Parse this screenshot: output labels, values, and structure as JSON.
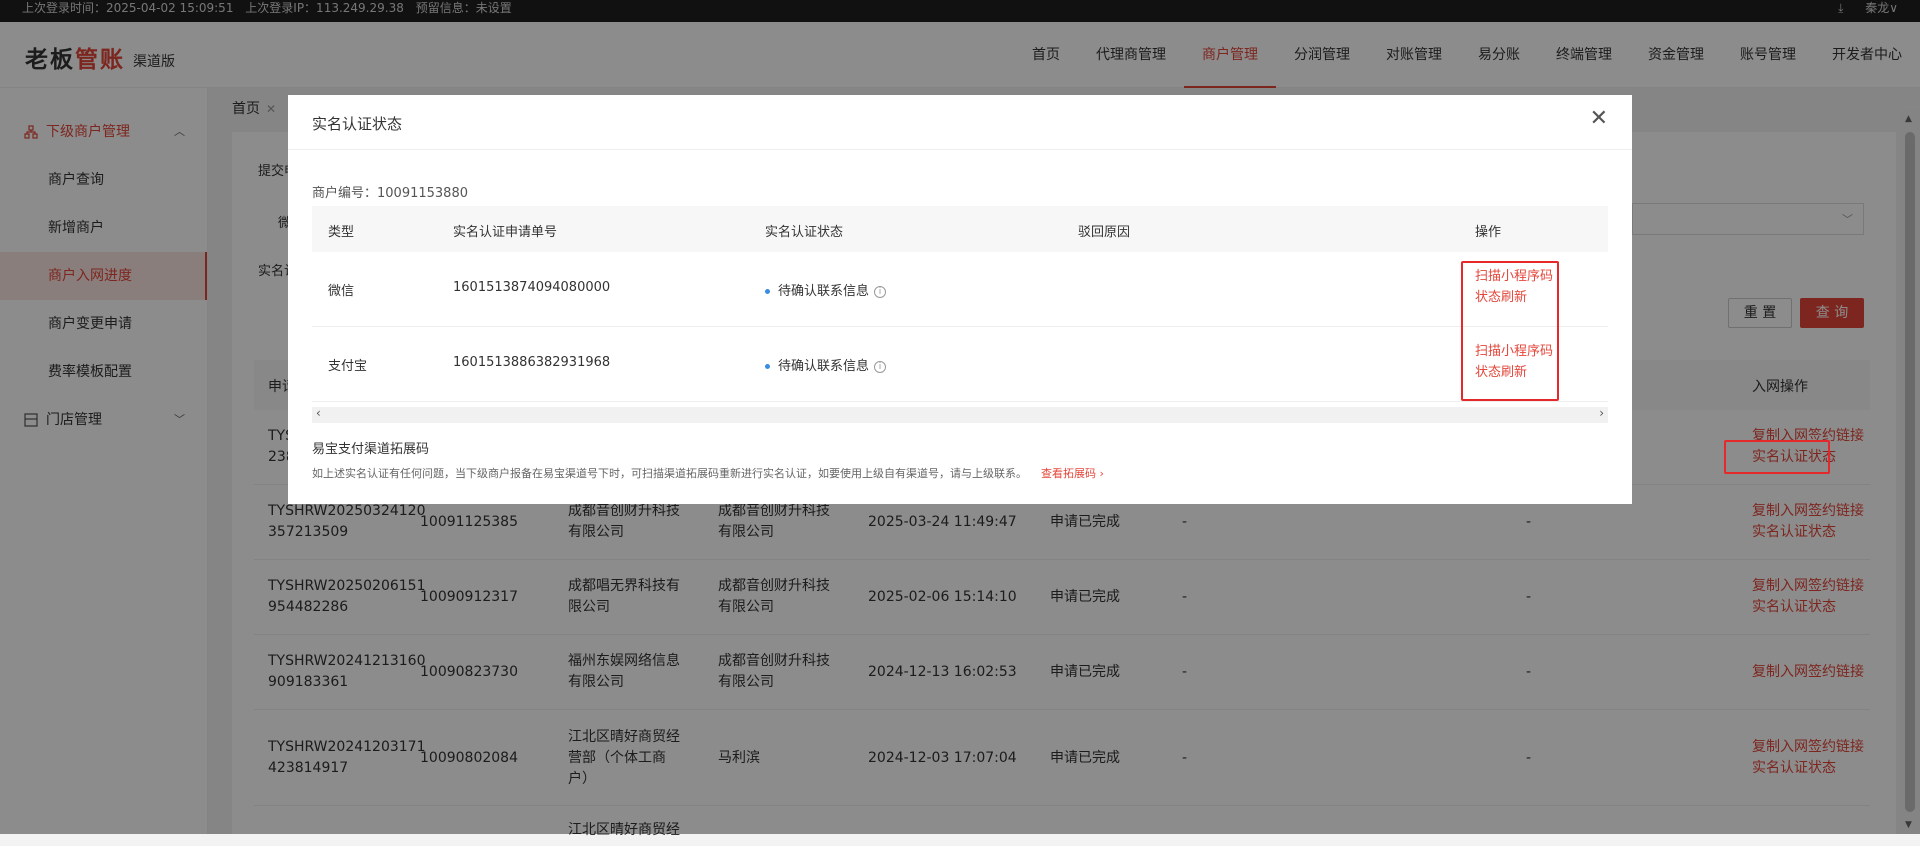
{
  "topbar": {
    "last_login_time": "上次登录时间：2025-04-02 15:09:51",
    "last_login_ip": "上次登录IP：113.249.29.38",
    "warning": "预留信息：未设置",
    "user": "秦龙∨"
  },
  "header": {
    "logo_part1": "老板",
    "logo_part2": "管账",
    "logo_suffix": "渠道版",
    "nav": [
      "首页",
      "代理商管理",
      "商户管理",
      "分润管理",
      "对账管理",
      "易分账",
      "终端管理",
      "资金管理",
      "账号管理",
      "开发者中心"
    ],
    "active_nav": "商户管理"
  },
  "sidebar": {
    "group1": "下级商户管理",
    "items": [
      "商户查询",
      "新增商户",
      "商户入网进度",
      "商户变更申请",
      "费率模板配置"
    ],
    "active_item": "商户入网进度",
    "group2": "门店管理"
  },
  "tabs": {
    "home": "首页"
  },
  "filters": {
    "label1": "提交申",
    "label2": "微",
    "label3": "实名认"
  },
  "buttons": {
    "reset": "重 置",
    "query": "查 询"
  },
  "table": {
    "headers": {
      "first": "申请",
      "last": "入网操作"
    },
    "rows": [
      {
        "id": "TYSH...",
        "id2": "238...",
        "links": [
          "复制入网签约链接",
          "实名认证状态"
        ]
      },
      {
        "id": "TYSHRW20250324120",
        "id2": "357213509",
        "merchant_no": "10091125385",
        "name": "成都音创财升科技有限公司",
        "agent": "成都音创财升科技有限公司",
        "time": "2025-03-24 11:49:47",
        "status": "申请已完成",
        "dash1": "-",
        "dash2": "-",
        "links": [
          "复制入网签约链接",
          "实名认证状态"
        ]
      },
      {
        "id": "TYSHRW20250206151",
        "id2": "954482286",
        "merchant_no": "10090912317",
        "name": "成都唱无界科技有限公司",
        "agent": "成都音创财升科技有限公司",
        "time": "2025-02-06 15:14:10",
        "status": "申请已完成",
        "dash1": "-",
        "dash2": "-",
        "links": [
          "复制入网签约链接",
          "实名认证状态"
        ]
      },
      {
        "id": "TYSHRW20241213160",
        "id2": "909183361",
        "merchant_no": "10090823730",
        "name": "福州东娱网络信息有限公司",
        "agent": "成都音创财升科技有限公司",
        "time": "2024-12-13 16:02:53",
        "status": "申请已完成",
        "dash1": "-",
        "dash2": "-",
        "links": [
          "复制入网签约链接"
        ]
      },
      {
        "id": "TYSHRW20241203171",
        "id2": "423814917",
        "merchant_no": "10090802084",
        "name": "江北区晴好商贸经营部（个体工商户）",
        "agent": "马利滨",
        "time": "2024-12-03 17:07:04",
        "status": "申请已完成",
        "dash1": "-",
        "dash2": "-",
        "links": [
          "复制入网签约链接",
          "实名认证状态"
        ]
      },
      {
        "name": "江北区晴好商贸经"
      }
    ]
  },
  "modal": {
    "title": "实名认证状态",
    "merchant_no": "商户编号：10091153880",
    "headers": [
      "类型",
      "实名认证申请单号",
      "实名认证状态",
      "驳回原因",
      "操作"
    ],
    "rows": [
      {
        "type": "微信",
        "apply_no": "1601513874094080000",
        "status": "待确认联系信息",
        "ops": [
          "扫描小程序码",
          "状态刷新"
        ]
      },
      {
        "type": "支付宝",
        "apply_no": "1601513886382931968",
        "status": "待确认联系信息",
        "ops": [
          "扫描小程序码",
          "状态刷新"
        ]
      }
    ],
    "channel_title": "易宝支付渠道拓展码",
    "note": "如上述实名认证有任何问题，当下级商户报备在易宝渠道号下时，可扫描渠道拓展码重新进行实名认证，如要使用上级自有渠道号，请与上级联系。",
    "note_link": "查看拓展码 ›"
  }
}
